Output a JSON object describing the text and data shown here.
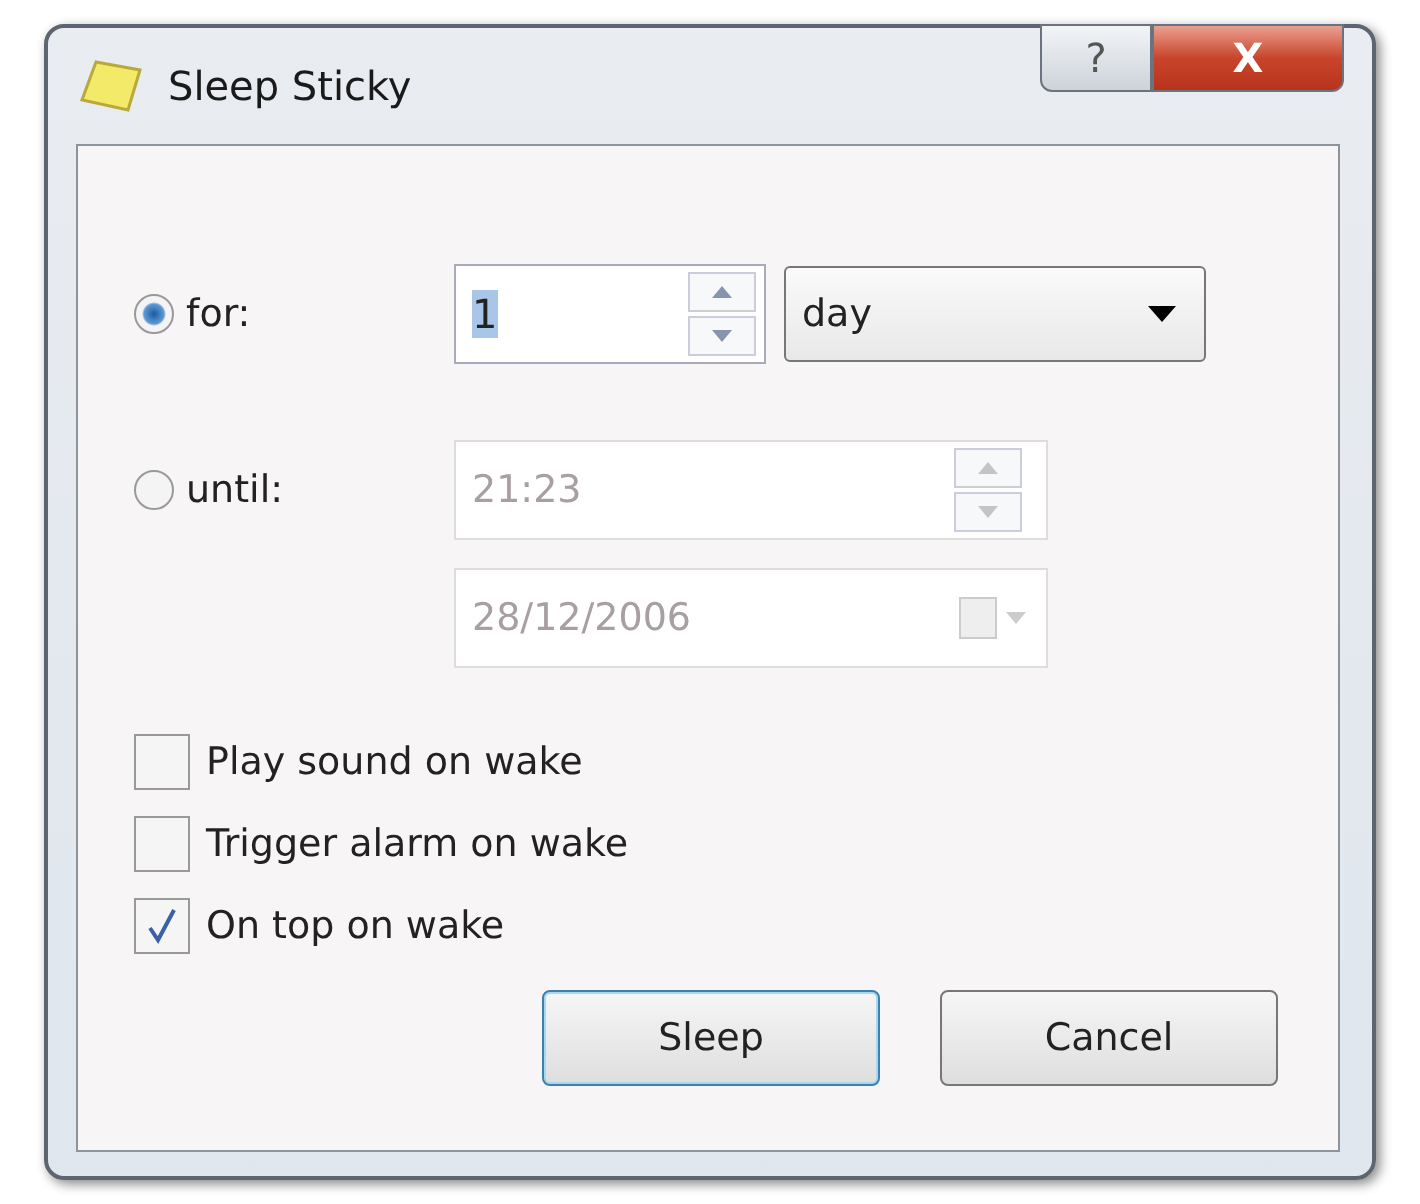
{
  "window": {
    "title": "Sleep Sticky",
    "buttons": [
      {
        "kind": "help",
        "label": "?"
      },
      {
        "kind": "close",
        "label": "X"
      }
    ]
  },
  "for": {
    "label": "for:",
    "selected": true,
    "value": "1",
    "unit": "day"
  },
  "until": {
    "label": "until:",
    "selected": false,
    "time": "21:23",
    "date": "28/12/2006",
    "disabled": true
  },
  "options": [
    {
      "label": "Play sound on wake",
      "checked": false
    },
    {
      "label": "Trigger alarm on wake",
      "checked": false
    },
    {
      "label": "On top on wake",
      "checked": true
    }
  ],
  "buttons": [
    {
      "label": "Sleep",
      "default": true
    },
    {
      "label": "Cancel",
      "default": false
    }
  ]
}
